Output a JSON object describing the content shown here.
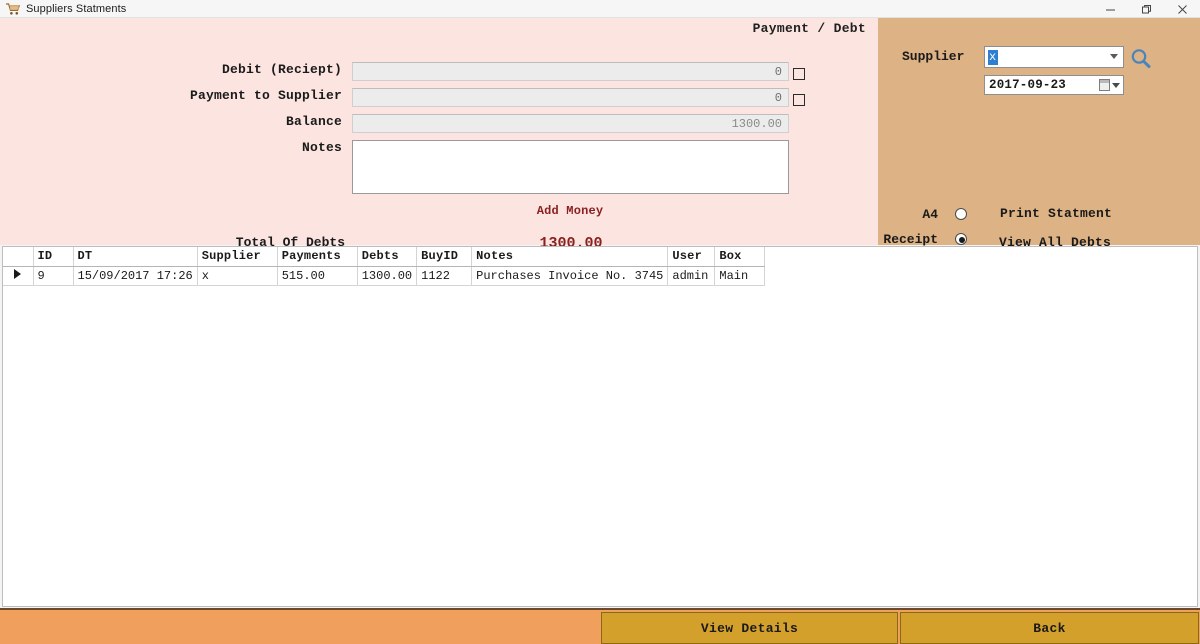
{
  "window": {
    "title": "Suppliers Statments",
    "icon": "cart-icon",
    "controls": {
      "minimize": "minimize-icon",
      "maximize": "restore-icon",
      "close": "close-icon"
    }
  },
  "form": {
    "panel_title": "Payment / Debt",
    "debit_label": "Debit (Reciept)",
    "debit_value": "0",
    "debit_checkbox_checked": false,
    "payment_label": "Payment to Supplier",
    "payment_value": "0",
    "payment_checkbox_checked": false,
    "balance_label": "Balance",
    "balance_value": "1300.00",
    "notes_label": "Notes",
    "notes_value": "",
    "add_money_label": "Add Money",
    "total_label": "Total Of Debts",
    "total_value": "1300.00",
    "accent_color": "#8a2020",
    "background_color": "#fce5e1"
  },
  "side": {
    "supplier_label": "Supplier",
    "supplier_value": "x",
    "search_icon": "magnifier-icon",
    "date_value": "2017-09-23",
    "a4_label": "A4",
    "a4_selected": false,
    "receipt_label": "Receipt",
    "receipt_selected": true,
    "print_statement_label": "Print Statment",
    "view_all_debts_label": "View All Debts",
    "background_color": "#ddb284"
  },
  "grid": {
    "columns": [
      "ID",
      "DT",
      "Supplier",
      "Payments",
      "Debts",
      "BuyID",
      "Notes",
      "User",
      "Box"
    ],
    "rows": [
      {
        "selected": true,
        "cells": [
          "9",
          "15/09/2017 17:26",
          "x",
          "515.00",
          "1300.00",
          "1122",
          "Purchases Invoice No. 3745",
          "admin",
          "Main"
        ]
      }
    ],
    "selection_color": "#1c86d6"
  },
  "footer": {
    "view_details_label": "View Details",
    "back_label": "Back",
    "background_color": "#f0a05c",
    "button_color": "#d4a02c"
  }
}
